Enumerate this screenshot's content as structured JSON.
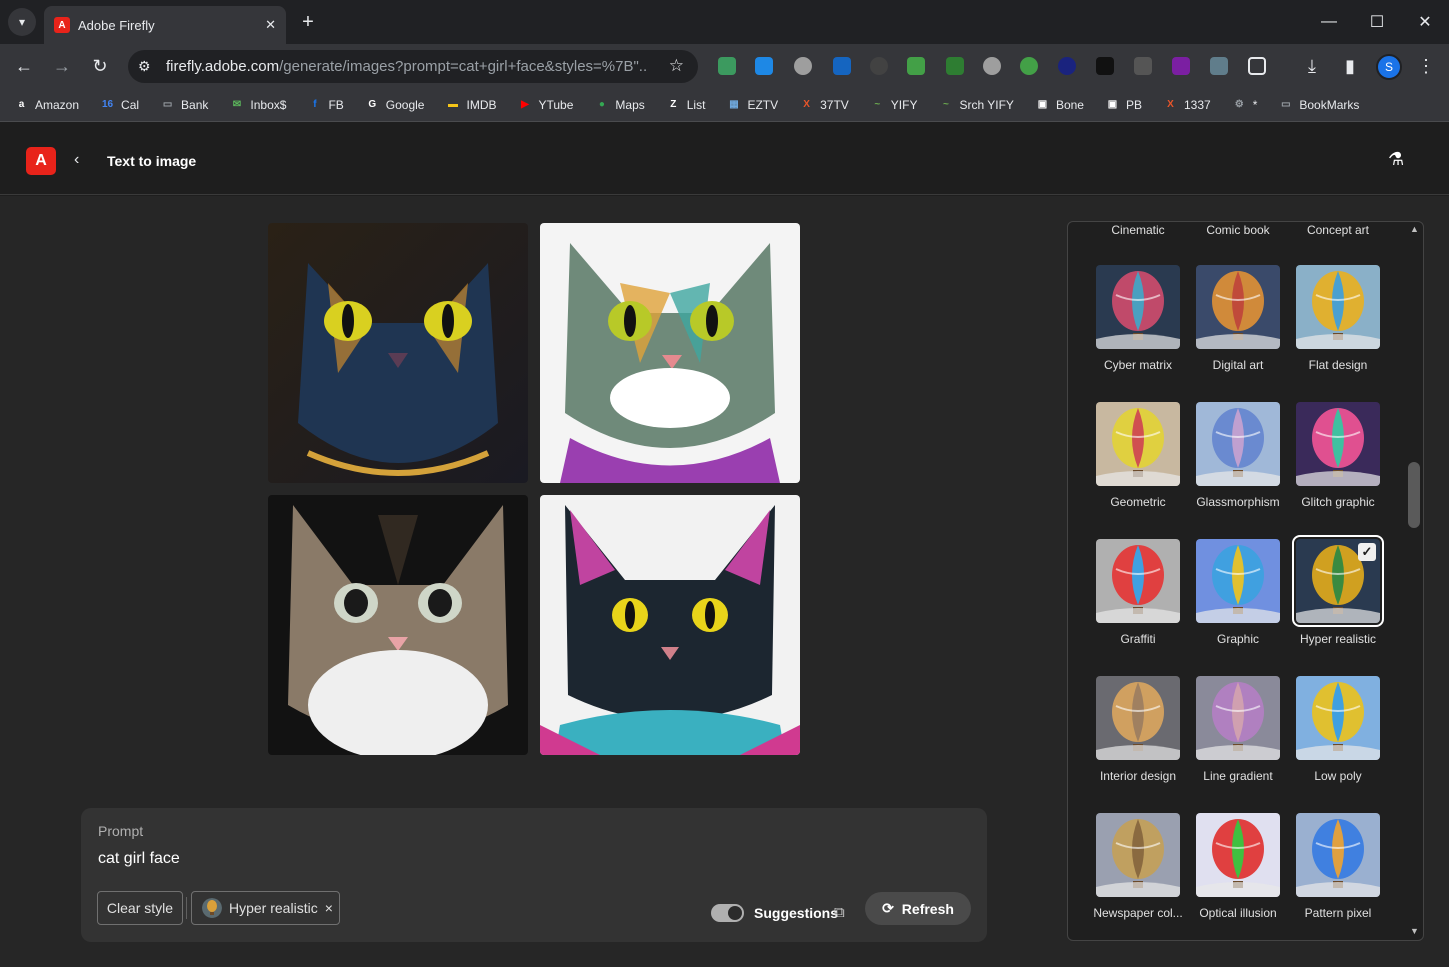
{
  "browser": {
    "tab_title": "Adobe Firefly",
    "url_domain": "firefly.adobe.com",
    "url_path": "/generate/images?prompt=cat+girl+face&styles=%7B\"...",
    "profile_initial": "S",
    "bookmarks": [
      {
        "label": "Amazon",
        "icon": "amazon-icon",
        "color": "#ffffff"
      },
      {
        "label": "Cal",
        "icon": "calendar-icon",
        "color": "#4285f4"
      },
      {
        "label": "Bank",
        "icon": "folder-icon",
        "color": "#9aa0a6"
      },
      {
        "label": "Inbox$",
        "icon": "inbox-icon",
        "color": "#5cb85c"
      },
      {
        "label": "FB",
        "icon": "facebook-icon",
        "color": "#1877f2"
      },
      {
        "label": "Google",
        "icon": "google-icon",
        "color": "#ffffff"
      },
      {
        "label": "IMDB",
        "icon": "imdb-icon",
        "color": "#f5c518"
      },
      {
        "label": "YTube",
        "icon": "youtube-icon",
        "color": "#ff0000"
      },
      {
        "label": "Maps",
        "icon": "maps-icon",
        "color": "#34a853"
      },
      {
        "label": "List",
        "icon": "list-icon",
        "color": "#ffffff"
      },
      {
        "label": "EZTV",
        "icon": "eztv-icon",
        "color": "#6fa8dc"
      },
      {
        "label": "37TV",
        "icon": "x-icon",
        "color": "#e8552a"
      },
      {
        "label": "YIFY",
        "icon": "yify-icon",
        "color": "#6aa84f"
      },
      {
        "label": "Srch YIFY",
        "icon": "yify-icon",
        "color": "#6aa84f"
      },
      {
        "label": "Bone",
        "icon": "bone-icon",
        "color": "#ffffff"
      },
      {
        "label": "PB",
        "icon": "pb-icon",
        "color": "#ffffff"
      },
      {
        "label": "1337",
        "icon": "x-icon",
        "color": "#e8552a"
      },
      {
        "label": "*",
        "icon": "gear-icon",
        "color": "#9aa0a6"
      },
      {
        "label": "BookMarks",
        "icon": "folder-icon",
        "color": "#9aa0a6"
      }
    ]
  },
  "app": {
    "page_title": "Text to image",
    "brand_color": "#e8231a"
  },
  "prompt": {
    "label": "Prompt",
    "text": "cat girl face",
    "clear_style_label": "Clear style",
    "selected_style_chip": "Hyper realistic",
    "chip_remove": "×",
    "suggestions_label": "Suggestions",
    "suggestions_enabled": true,
    "refresh_label": "Refresh"
  },
  "styles": {
    "top_row": [
      "Cinematic",
      "Comic book",
      "Concept art"
    ],
    "items": [
      {
        "label": "Cyber matrix",
        "selected": false
      },
      {
        "label": "Digital art",
        "selected": false
      },
      {
        "label": "Flat design",
        "selected": false
      },
      {
        "label": "Geometric",
        "selected": false
      },
      {
        "label": "Glassmorphism",
        "selected": false
      },
      {
        "label": "Glitch graphic",
        "selected": false
      },
      {
        "label": "Graffiti",
        "selected": false
      },
      {
        "label": "Graphic",
        "selected": false
      },
      {
        "label": "Hyper realistic",
        "selected": true
      },
      {
        "label": "Interior design",
        "selected": false
      },
      {
        "label": "Line gradient",
        "selected": false
      },
      {
        "label": "Low poly",
        "selected": false
      },
      {
        "label": "Newspaper col...",
        "selected": false
      },
      {
        "label": "Optical illusion",
        "selected": false
      },
      {
        "label": "Pattern pixel",
        "selected": false
      }
    ]
  }
}
